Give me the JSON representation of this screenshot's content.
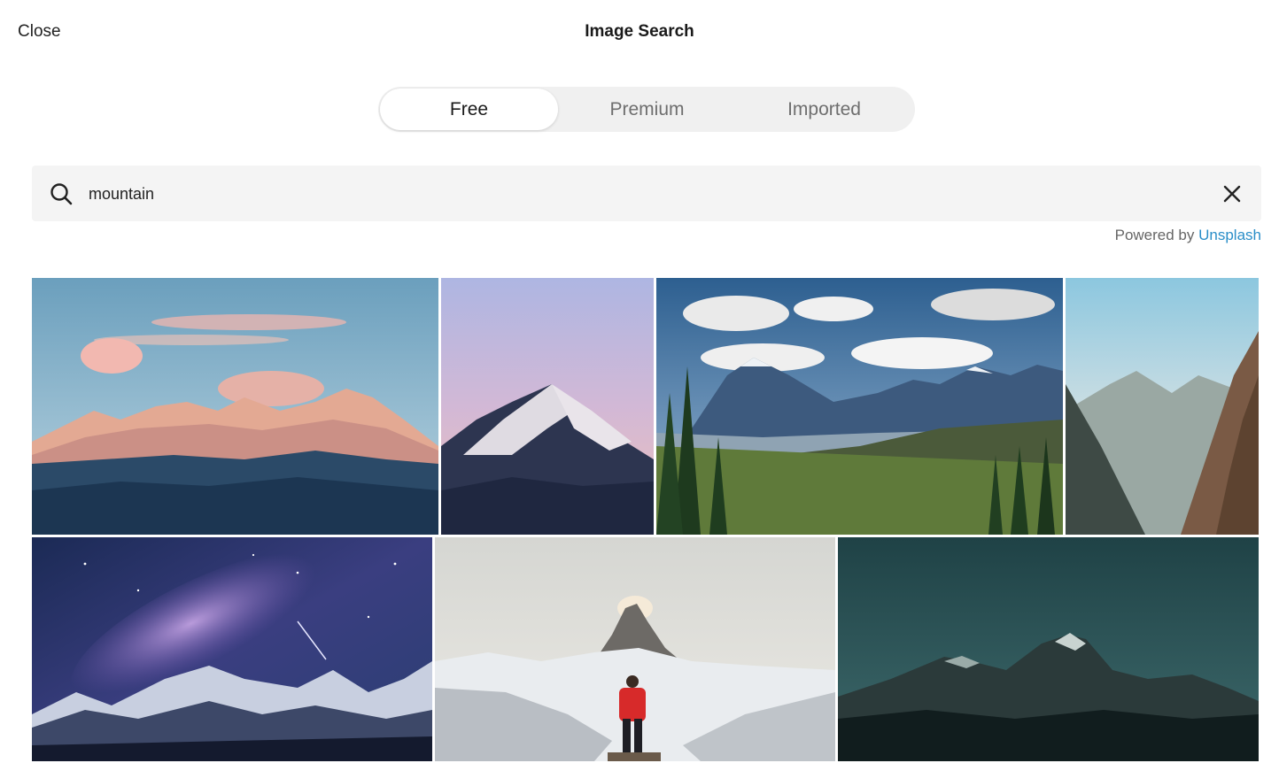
{
  "header": {
    "close_label": "Close",
    "title": "Image Search"
  },
  "tabs": [
    {
      "label": "Free",
      "active": true
    },
    {
      "label": "Premium",
      "active": false
    },
    {
      "label": "Imported",
      "active": false
    }
  ],
  "search": {
    "value": "mountain",
    "icon": "search-icon",
    "clear_icon": "close-icon"
  },
  "attribution": {
    "prefix": "Powered by",
    "link": "Unsplash"
  },
  "colors": {
    "link": "#2a8ec8",
    "active_tab": "#ffffff",
    "tab_track": "#f0f0f0",
    "search_bg": "#f4f4f4"
  }
}
